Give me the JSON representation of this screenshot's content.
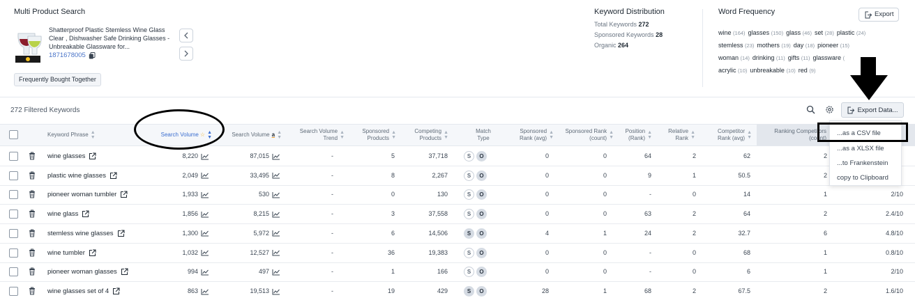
{
  "header": {
    "title": "Multi Product Search",
    "product_name": "Shatterproof Plastic Stemless Wine Glass Clear , Dishwasher Safe Drinking Glasses - Unbreakable Glassware for...",
    "asin": "1871678005",
    "fbt_label": "Frequently Bought Together"
  },
  "keyword_distribution": {
    "title": "Keyword Distribution",
    "total_label": "Total Keywords",
    "total": "272",
    "sponsored_label": "Sponsored Keywords",
    "sponsored": "28",
    "organic_label": "Organic",
    "organic": "264"
  },
  "word_frequency": {
    "title": "Word Frequency",
    "export_label": "Export",
    "rows": [
      [
        {
          "w": "wine",
          "c": "(164)"
        },
        {
          "w": "glasses",
          "c": "(150)"
        },
        {
          "w": "glass",
          "c": "(46)"
        },
        {
          "w": "set",
          "c": "(28)"
        },
        {
          "w": "plastic",
          "c": "(24)"
        }
      ],
      [
        {
          "w": "stemless",
          "c": "(23)"
        },
        {
          "w": "mothers",
          "c": "(19)"
        },
        {
          "w": "day",
          "c": "(18)"
        },
        {
          "w": "pioneer",
          "c": "(15)"
        }
      ],
      [
        {
          "w": "woman",
          "c": "(14)"
        },
        {
          "w": "drinking",
          "c": "(11)"
        },
        {
          "w": "gifts",
          "c": "(11)"
        },
        {
          "w": "glassware",
          "c": "("
        }
      ],
      [
        {
          "w": "acrylic",
          "c": "(10)"
        },
        {
          "w": "unbreakable",
          "c": "(10)"
        },
        {
          "w": "red",
          "c": "(9)"
        }
      ]
    ]
  },
  "toolbar": {
    "filtered_label": "272 Filtered Keywords",
    "export_data_label": "Export Data..."
  },
  "columns": {
    "keyword": "Keyword Phrase",
    "search_volume": "Search Volume",
    "search_volume_amazon": "Search Volume",
    "sv_trend": "Search Volume Trend",
    "sponsored_products": "Sponsored Products",
    "competing_products": "Competing Products",
    "match_type": "Match Type",
    "sponsored_rank_avg": "Sponsored Rank (avg)",
    "sponsored_rank_count": "Sponsored Rank (count)",
    "position_rank": "Position (Rank)",
    "relative_rank": "Relative Rank",
    "competitor_rank_avg": "Competitor Rank (avg)",
    "ranking_competitors": "Ranking Competitors (count)"
  },
  "rows": [
    {
      "kw": "wine glasses",
      "sv": "8,220",
      "sva": "87,015",
      "trend": "-",
      "sp": "5",
      "cp": "37,718",
      "s": false,
      "spra": "0",
      "sprc": "0",
      "pos": "64",
      "rel": "2",
      "cra": "62",
      "rc": "2",
      "extra": ""
    },
    {
      "kw": "plastic wine glasses",
      "sv": "2,049",
      "sva": "33,495",
      "trend": "-",
      "sp": "8",
      "cp": "2,267",
      "s": false,
      "spra": "0",
      "sprc": "0",
      "pos": "9",
      "rel": "1",
      "cra": "50.5",
      "rc": "2",
      "extra": ""
    },
    {
      "kw": "pioneer woman tumbler",
      "sv": "1,933",
      "sva": "530",
      "trend": "-",
      "sp": "0",
      "cp": "130",
      "s": false,
      "spra": "0",
      "sprc": "0",
      "pos": "-",
      "rel": "0",
      "cra": "14",
      "rc": "1",
      "extra": "2/10"
    },
    {
      "kw": "wine glass",
      "sv": "1,856",
      "sva": "8,215",
      "trend": "-",
      "sp": "3",
      "cp": "37,558",
      "s": false,
      "spra": "0",
      "sprc": "0",
      "pos": "63",
      "rel": "2",
      "cra": "64",
      "rc": "2",
      "extra": "2.4/10"
    },
    {
      "kw": "stemless wine glasses",
      "sv": "1,300",
      "sva": "5,972",
      "trend": "-",
      "sp": "6",
      "cp": "14,506",
      "s": true,
      "spra": "4",
      "sprc": "1",
      "pos": "24",
      "rel": "2",
      "cra": "32.7",
      "rc": "6",
      "extra": "4.8/10"
    },
    {
      "kw": "wine tumbler",
      "sv": "1,032",
      "sva": "12,527",
      "trend": "-",
      "sp": "36",
      "cp": "19,383",
      "s": false,
      "spra": "0",
      "sprc": "0",
      "pos": "-",
      "rel": "0",
      "cra": "68",
      "rc": "1",
      "extra": "0.8/10"
    },
    {
      "kw": "pioneer woman glasses",
      "sv": "994",
      "sva": "497",
      "trend": "-",
      "sp": "1",
      "cp": "166",
      "s": false,
      "spra": "0",
      "sprc": "0",
      "pos": "-",
      "rel": "0",
      "cra": "6",
      "rc": "1",
      "extra": "2/10"
    },
    {
      "kw": "wine glasses set of 4",
      "sv": "863",
      "sva": "19,513",
      "trend": "-",
      "sp": "19",
      "cp": "429",
      "s": true,
      "spra": "28",
      "sprc": "1",
      "pos": "68",
      "rel": "2",
      "cra": "67.5",
      "rc": "2",
      "extra": "1.6/10"
    }
  ],
  "match_labels": {
    "s": "S",
    "o": "O"
  },
  "export_menu": {
    "items": [
      "...as a CSV file",
      "...as a XLSX file",
      "...to Frankenstein",
      "copy to Clipboard"
    ]
  },
  "colors": {
    "accent": "#3c6fd0",
    "link": "#4a74c8"
  }
}
